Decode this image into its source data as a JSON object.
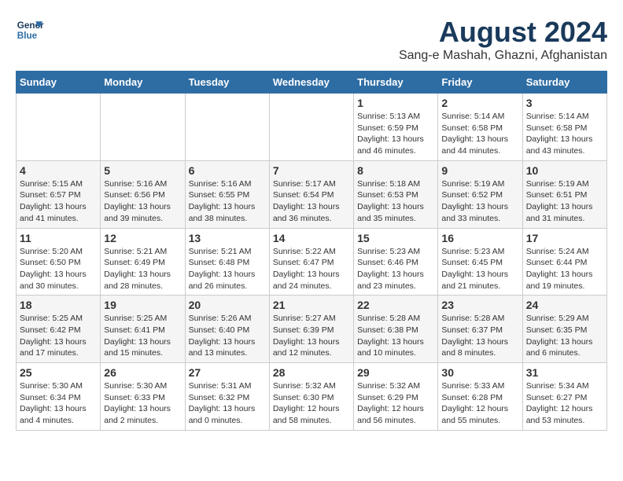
{
  "logo": {
    "line1": "General",
    "line2": "Blue"
  },
  "title": "August 2024",
  "subtitle": "Sang-e Mashah, Ghazni, Afghanistan",
  "days_of_week": [
    "Sunday",
    "Monday",
    "Tuesday",
    "Wednesday",
    "Thursday",
    "Friday",
    "Saturday"
  ],
  "weeks": [
    [
      {
        "day": "",
        "info": ""
      },
      {
        "day": "",
        "info": ""
      },
      {
        "day": "",
        "info": ""
      },
      {
        "day": "",
        "info": ""
      },
      {
        "day": "1",
        "info": "Sunrise: 5:13 AM\nSunset: 6:59 PM\nDaylight: 13 hours and 46 minutes."
      },
      {
        "day": "2",
        "info": "Sunrise: 5:14 AM\nSunset: 6:58 PM\nDaylight: 13 hours and 44 minutes."
      },
      {
        "day": "3",
        "info": "Sunrise: 5:14 AM\nSunset: 6:58 PM\nDaylight: 13 hours and 43 minutes."
      }
    ],
    [
      {
        "day": "4",
        "info": "Sunrise: 5:15 AM\nSunset: 6:57 PM\nDaylight: 13 hours and 41 minutes."
      },
      {
        "day": "5",
        "info": "Sunrise: 5:16 AM\nSunset: 6:56 PM\nDaylight: 13 hours and 39 minutes."
      },
      {
        "day": "6",
        "info": "Sunrise: 5:16 AM\nSunset: 6:55 PM\nDaylight: 13 hours and 38 minutes."
      },
      {
        "day": "7",
        "info": "Sunrise: 5:17 AM\nSunset: 6:54 PM\nDaylight: 13 hours and 36 minutes."
      },
      {
        "day": "8",
        "info": "Sunrise: 5:18 AM\nSunset: 6:53 PM\nDaylight: 13 hours and 35 minutes."
      },
      {
        "day": "9",
        "info": "Sunrise: 5:19 AM\nSunset: 6:52 PM\nDaylight: 13 hours and 33 minutes."
      },
      {
        "day": "10",
        "info": "Sunrise: 5:19 AM\nSunset: 6:51 PM\nDaylight: 13 hours and 31 minutes."
      }
    ],
    [
      {
        "day": "11",
        "info": "Sunrise: 5:20 AM\nSunset: 6:50 PM\nDaylight: 13 hours and 30 minutes."
      },
      {
        "day": "12",
        "info": "Sunrise: 5:21 AM\nSunset: 6:49 PM\nDaylight: 13 hours and 28 minutes."
      },
      {
        "day": "13",
        "info": "Sunrise: 5:21 AM\nSunset: 6:48 PM\nDaylight: 13 hours and 26 minutes."
      },
      {
        "day": "14",
        "info": "Sunrise: 5:22 AM\nSunset: 6:47 PM\nDaylight: 13 hours and 24 minutes."
      },
      {
        "day": "15",
        "info": "Sunrise: 5:23 AM\nSunset: 6:46 PM\nDaylight: 13 hours and 23 minutes."
      },
      {
        "day": "16",
        "info": "Sunrise: 5:23 AM\nSunset: 6:45 PM\nDaylight: 13 hours and 21 minutes."
      },
      {
        "day": "17",
        "info": "Sunrise: 5:24 AM\nSunset: 6:44 PM\nDaylight: 13 hours and 19 minutes."
      }
    ],
    [
      {
        "day": "18",
        "info": "Sunrise: 5:25 AM\nSunset: 6:42 PM\nDaylight: 13 hours and 17 minutes."
      },
      {
        "day": "19",
        "info": "Sunrise: 5:25 AM\nSunset: 6:41 PM\nDaylight: 13 hours and 15 minutes."
      },
      {
        "day": "20",
        "info": "Sunrise: 5:26 AM\nSunset: 6:40 PM\nDaylight: 13 hours and 13 minutes."
      },
      {
        "day": "21",
        "info": "Sunrise: 5:27 AM\nSunset: 6:39 PM\nDaylight: 13 hours and 12 minutes."
      },
      {
        "day": "22",
        "info": "Sunrise: 5:28 AM\nSunset: 6:38 PM\nDaylight: 13 hours and 10 minutes."
      },
      {
        "day": "23",
        "info": "Sunrise: 5:28 AM\nSunset: 6:37 PM\nDaylight: 13 hours and 8 minutes."
      },
      {
        "day": "24",
        "info": "Sunrise: 5:29 AM\nSunset: 6:35 PM\nDaylight: 13 hours and 6 minutes."
      }
    ],
    [
      {
        "day": "25",
        "info": "Sunrise: 5:30 AM\nSunset: 6:34 PM\nDaylight: 13 hours and 4 minutes."
      },
      {
        "day": "26",
        "info": "Sunrise: 5:30 AM\nSunset: 6:33 PM\nDaylight: 13 hours and 2 minutes."
      },
      {
        "day": "27",
        "info": "Sunrise: 5:31 AM\nSunset: 6:32 PM\nDaylight: 13 hours and 0 minutes."
      },
      {
        "day": "28",
        "info": "Sunrise: 5:32 AM\nSunset: 6:30 PM\nDaylight: 12 hours and 58 minutes."
      },
      {
        "day": "29",
        "info": "Sunrise: 5:32 AM\nSunset: 6:29 PM\nDaylight: 12 hours and 56 minutes."
      },
      {
        "day": "30",
        "info": "Sunrise: 5:33 AM\nSunset: 6:28 PM\nDaylight: 12 hours and 55 minutes."
      },
      {
        "day": "31",
        "info": "Sunrise: 5:34 AM\nSunset: 6:27 PM\nDaylight: 12 hours and 53 minutes."
      }
    ]
  ]
}
